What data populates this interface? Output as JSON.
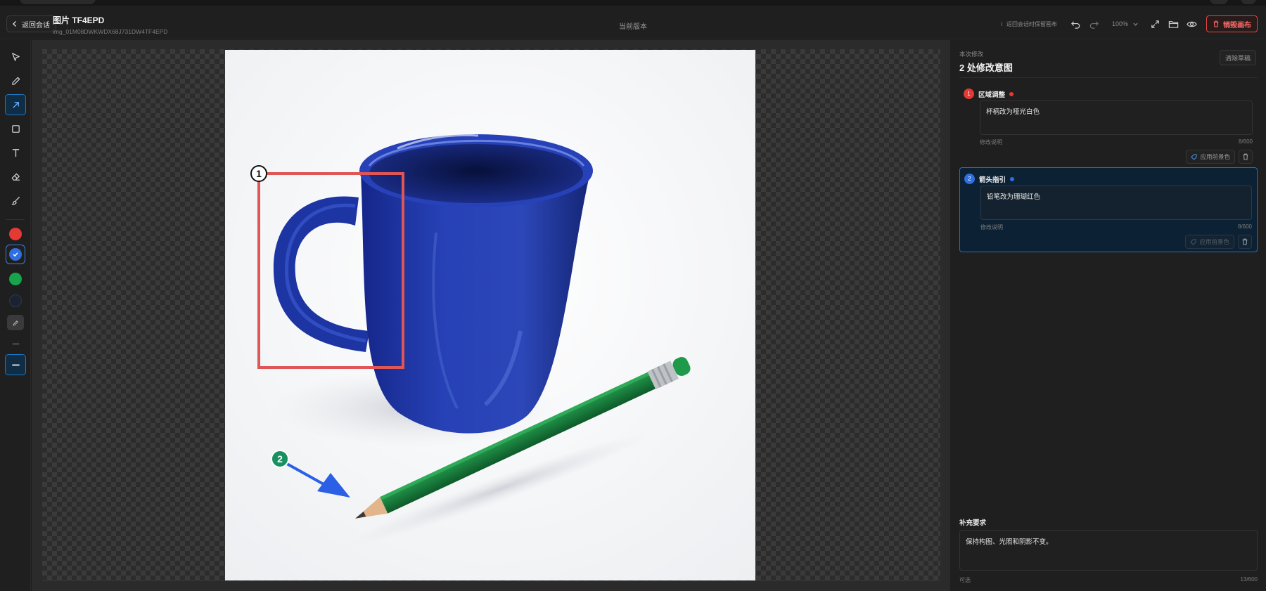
{
  "header": {
    "back_label": "返回会话",
    "image_title": "图片 TF4EPD",
    "image_id": "img_01M08DWKWDX68J731DW4TF4EPD",
    "version_label": "当前版本",
    "hint_icon": "i",
    "hint_text": "返回会话时保留画布",
    "zoom_value": "100%",
    "destroy_label": "销毁画布"
  },
  "toolbar": {
    "tools": [
      "select",
      "pen",
      "arrow",
      "rectangle",
      "text",
      "eraser",
      "brush"
    ],
    "active_tool": "arrow",
    "colors": [
      "#e53935",
      "#2f6fe0",
      "#17a44b",
      "#1b2333"
    ],
    "active_color": "#2f6fe0"
  },
  "panel": {
    "label": "本次修改",
    "title": "2 处修改意图",
    "clear_label": "清除草稿",
    "annotations": [
      {
        "number": "1",
        "title": "区域调整",
        "color": "#e53935",
        "text": "杯柄改为哑光白色",
        "field_label": "修改说明",
        "count": "8/600",
        "apply_label": "应用前景色"
      },
      {
        "number": "2",
        "title": "箭头指引",
        "color": "#2f6fe0",
        "text": "铅笔改为珊瑚红色",
        "field_label": "修改说明",
        "count": "8/600",
        "apply_label": "应用前景色"
      }
    ],
    "extra_label": "补充要求",
    "extra_text": "保持构图、光照和阴影不变。",
    "extra_hint": "可选",
    "extra_count": "13/600"
  },
  "canvas": {
    "marker_1": "1",
    "marker_2": "2"
  }
}
